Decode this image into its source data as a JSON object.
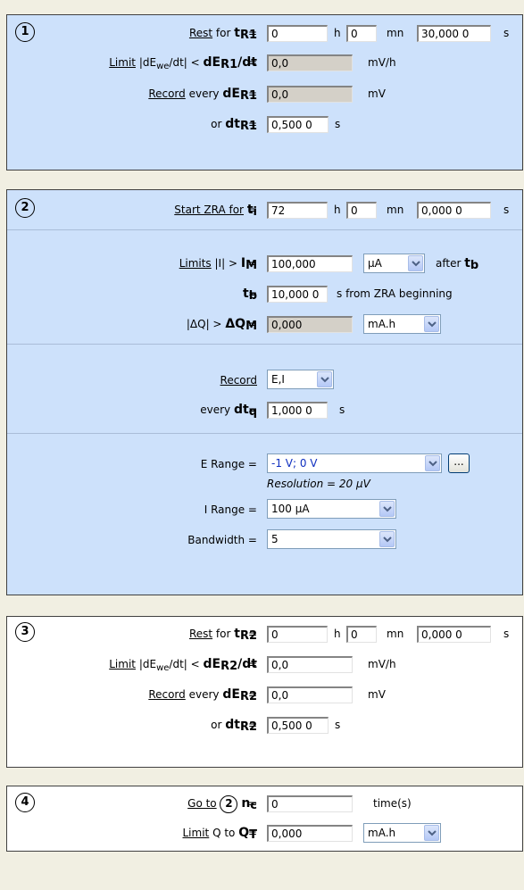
{
  "block1": {
    "number": "1",
    "rest_label": "Rest",
    "for_text": "for",
    "rest_symbol": "t",
    "rest_sub": "R1",
    "eq": "=",
    "rest_h": "0",
    "h_unit": "h",
    "rest_mn": "0",
    "mn_unit": "mn",
    "rest_s": "30,000 0",
    "s_unit": "s",
    "limit_label": "Limit",
    "limit_text": "|dE",
    "limit_text_sub": "we",
    "limit_text_end": "/dt| <",
    "limit_symbol": "dE",
    "limit_sub": "R1",
    "limit_symbol_end": "/dt",
    "limit_value": "0,0",
    "limit_unit": "mV/h",
    "record_label": "Record",
    "every_text": "every",
    "record_symbol": "dE",
    "record_sub": "R1",
    "record_value": "0,0",
    "record_unit": "mV",
    "or_text": "or",
    "dt_symbol": "dt",
    "dt_sub": "R1",
    "dt_value": "0,500 0",
    "dt_unit": "s"
  },
  "block2": {
    "number": "2",
    "start_label": "Start ZRA for",
    "ti_symbol": "t",
    "ti_sub": "i",
    "eq": "=",
    "ti_h": "72",
    "h_unit": "h",
    "ti_mn": "0",
    "mn_unit": "mn",
    "ti_s": "0,000 0",
    "s_unit": "s",
    "limits_label": "Limits",
    "limits_text": "|I| >",
    "im_symbol": "I",
    "im_sub": "M",
    "im_value": "100,000",
    "im_unit_select": "µA",
    "after_text": "after",
    "after_symbol": "t",
    "after_sub": "b",
    "tb_symbol": "t",
    "tb_sub": "b",
    "tb_value": "10,000 0",
    "tb_unit": "s from ZRA beginning",
    "dq_text": "|ΔQ| >",
    "dq_symbol": "ΔQ",
    "dq_sub": "M",
    "dq_value": "0,000",
    "dq_unit_select": "mA.h",
    "record_label": "Record",
    "record_select": "E,I",
    "every_text": "every",
    "dtq_symbol": "dt",
    "dtq_sub": "q",
    "dtq_value": "1,000 0",
    "dtq_unit": "s",
    "erange_label": "E Range =",
    "erange_select": "-1 V; 0 V",
    "erange_button": "...",
    "resolution_text": "Resolution = 20 µV",
    "irange_label": "I Range =",
    "irange_select": "100 µA",
    "bandwidth_label": "Bandwidth =",
    "bandwidth_select": "5"
  },
  "block3": {
    "number": "3",
    "rest_label": "Rest",
    "for_text": "for",
    "rest_symbol": "t",
    "rest_sub": "R2",
    "eq": "=",
    "rest_h": "0",
    "h_unit": "h",
    "rest_mn": "0",
    "mn_unit": "mn",
    "rest_s": "0,000 0",
    "s_unit": "s",
    "limit_label": "Limit",
    "limit_text": "|dE",
    "limit_text_sub": "we",
    "limit_text_end": "/dt| <",
    "limit_symbol": "dE",
    "limit_sub": "R2",
    "limit_symbol_end": "/dt",
    "limit_value": "0,0",
    "limit_unit": "mV/h",
    "record_label": "Record",
    "every_text": "every",
    "record_symbol": "dE",
    "record_sub": "R2",
    "record_value": "0,0",
    "record_unit": "mV",
    "or_text": "or",
    "dt_symbol": "dt",
    "dt_sub": "R2",
    "dt_value": "0,500 0",
    "dt_unit": "s"
  },
  "block4": {
    "number": "4",
    "goto_label": "Go to",
    "goto_target": "2",
    "nc_symbol": "n",
    "nc_sub": "c",
    "eq": "=",
    "nc_value": "0",
    "nc_unit": "time(s)",
    "limit_label": "Limit",
    "limit_text": "Q to",
    "qt_symbol": "Q",
    "qt_sub": "T",
    "qt_value": "0,000",
    "qt_unit_select": "mA.h"
  },
  "colors": {
    "panel_blue": "#cde1fb",
    "panel_white": "#ffffff",
    "background": "#f1efe2"
  }
}
